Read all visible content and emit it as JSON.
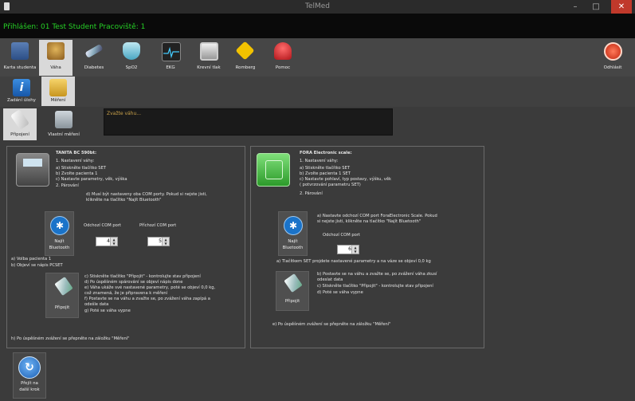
{
  "window": {
    "title": "TelMed",
    "minimize": "–",
    "maximize": "□",
    "close": "✕"
  },
  "status": {
    "text": "Přihlášen: 01 Test Student Pracoviště: 1"
  },
  "toolbar": {
    "items": [
      {
        "label": "Karta studenta",
        "icon": "student-card-icon"
      },
      {
        "label": "Váha",
        "icon": "scale-icon"
      },
      {
        "label": "Diabetes",
        "icon": "syringe-icon"
      },
      {
        "label": "SpO2",
        "icon": "shield-icon"
      },
      {
        "label": "EKG",
        "icon": "ecg-icon"
      },
      {
        "label": "Krevní tlak",
        "icon": "blood-pressure-icon"
      },
      {
        "label": "Romberg",
        "icon": "walking-sign-icon"
      },
      {
        "label": "Pomoc",
        "icon": "emergency-button-icon"
      }
    ],
    "logout": {
      "label": "Odhlásit",
      "icon": "power-icon"
    }
  },
  "subtoolbar": {
    "items": [
      {
        "label": "Zadání úlohy",
        "icon": "info-icon"
      },
      {
        "label": "Měření",
        "icon": "folder-icon"
      }
    ]
  },
  "subtoolbar2": {
    "items": [
      {
        "label": "Připojení",
        "icon": "plug-icon"
      },
      {
        "label": "Vlastní měření",
        "icon": "computer-icon"
      }
    ]
  },
  "message": {
    "text": "Zvažte váhu..."
  },
  "tanita": {
    "title": "TANITA BC 590bt:",
    "setup": [
      "1. Nastavení váhy:",
      "a) Stiskněte tlačítko SET",
      "b) Zvolte pacienta 1",
      "c) Nastavte parametry, věk, výška",
      "2. Párování"
    ],
    "com_note": [
      "d) Musí být nastaveny oba COM porty. Pokud si nejste jisti,",
      "klikněte na tlačítko \"Najít Bluetooth\""
    ],
    "bluetooth_label": [
      "Najít",
      "Bluetooth"
    ],
    "out_port_label": "Odchozí COM port",
    "in_port_label": "Příchozí COM port",
    "out_port_value": "4",
    "in_port_value": "5",
    "select_steps": [
      "a) Volba pacienta 1",
      "b) Objeví se nápis PCSET"
    ],
    "connect_steps": [
      "c) Stiskněte tlačítko \"Připojit\" - kontrolujte stav připojení",
      "d) Po úspěšném spárování se objeví nápis done",
      "e) Váha ukáže své nastavené parametry, poté se objeví 0,0 kg,",
      "což znamená, že je připravena k měření",
      "f) Postavte se na váhu a zvažte se, po zvážení váha zapípá a",
      "odešle data",
      "g) Poté se váha vypne"
    ],
    "connect_label": "Připojit",
    "final": "h) Po úspěšném zvážení se přepněte na záložku \"Měření\""
  },
  "fora": {
    "title": "FORA Electronic scale:",
    "setup": [
      "1. Nastavení váhy:",
      "a) Stiskněte tlačítko SET",
      "b) Zvolte pacienta 1 SET",
      "c) Nastavte pohlaví, typ postavy, výšku, věk",
      "( potvrzování parametru SET)",
      "2. Párování"
    ],
    "com_note": [
      "a) Nastavte odchozí COM port ForaElectronic Scale. Pokud",
      "si nejste jisti, klikněte na tlačítko \"Najít Bluetooth\""
    ],
    "bluetooth_label": [
      "Najít",
      "Bluetooth"
    ],
    "out_port_label": "Odchozí COM port",
    "out_port_value": "6",
    "set_note": "a) Tlačítkem SET projdete nastavené parametry a na váze se objeví 0,0 kg",
    "connect_steps": [
      "b) Postavte se na váhu a zvažte se, po zvážení váha zkusí",
      "odeslat data",
      "c) Stiskněte tlačítko \"Připojit\" - kontrolujte stav připojení",
      "d) Poté se váha vypne"
    ],
    "connect_label": "Připojit",
    "final": "e) Po úspěšném zvážení se přepněte na záložku \"Měření\""
  },
  "next": {
    "label": [
      "Přejít na",
      "další krok"
    ],
    "icon": "arrow-circle-icon"
  }
}
